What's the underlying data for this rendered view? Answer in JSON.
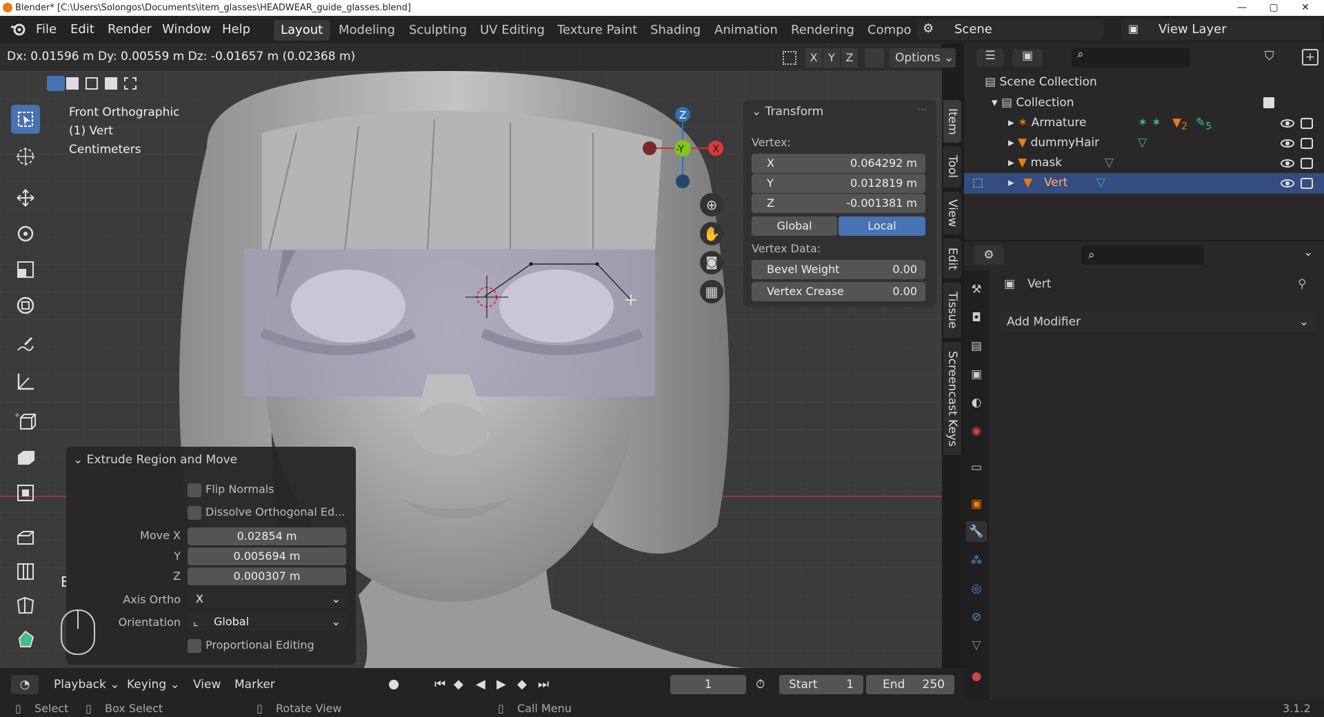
{
  "titlebar": {
    "title": "Blender* [C:\\Users\\Solongos\\Documents\\item_glasses\\HEADWEAR_guide_glasses.blend]",
    "min": "—",
    "max": "▢",
    "close": "✕"
  },
  "menu": [
    "File",
    "Edit",
    "Render",
    "Window",
    "Help"
  ],
  "workspaces": [
    "Layout",
    "Modeling",
    "Sculpting",
    "UV Editing",
    "Texture Paint",
    "Shading",
    "Animation",
    "Rendering",
    "Compo"
  ],
  "scene": {
    "label": "Scene",
    "view_layer": "View Layer"
  },
  "header": {
    "transform_readout": "Dx: 0.01596 m   Dy: 0.00559 m   Dz: -0.01657 m (0.02368 m)",
    "axis_x": "X",
    "axis_y": "Y",
    "axis_z": "Z",
    "options": "Options"
  },
  "viewport": {
    "view_name": "Front Orthographic",
    "object": "(1) Vert",
    "units": "Centimeters",
    "key_hint": "E"
  },
  "gizmo": {
    "z": "Z",
    "y": "-Y",
    "x": "X"
  },
  "npanel": {
    "section": "Transform",
    "vertex_label": "Vertex:",
    "x_label": "X",
    "x_val": "0.064292 m",
    "y_label": "Y",
    "y_val": "0.012819 m",
    "z_label": "Z",
    "z_val": "-0.001381 m",
    "global": "Global",
    "local": "Local",
    "vertex_data": "Vertex Data:",
    "bevel_label": "Bevel Weight",
    "bevel_val": "0.00",
    "crease_label": "Vertex Crease",
    "crease_val": "0.00"
  },
  "sidetabs": [
    "Item",
    "Tool",
    "View",
    "Edit",
    "Tissue",
    "Screencast Keys"
  ],
  "operator": {
    "title": "Extrude Region and Move",
    "flip": "Flip Normals",
    "dissolve": "Dissolve Orthogonal Ed...",
    "move_x_label": "Move X",
    "move_x": "0.02854 m",
    "y_label": "Y",
    "move_y": "0.005694 m",
    "z_label": "Z",
    "move_z": "0.000307 m",
    "axis_ortho_label": "Axis Ortho",
    "axis_ortho": "X",
    "orientation_label": "Orientation",
    "orientation": "Global",
    "proportional": "Proportional Editing"
  },
  "timeline": {
    "playback": "Playback",
    "keying": "Keying",
    "view": "View",
    "marker": "Marker",
    "frame": "1",
    "start_label": "Start",
    "start": "1",
    "end_label": "End",
    "end": "250"
  },
  "status": {
    "select": "Select",
    "box_select": "Box Select",
    "rotate_view": "Rotate View",
    "call_menu": "Call Menu",
    "version": "3.1.2"
  },
  "outliner": {
    "scene_collection": "Scene Collection",
    "collection": "Collection",
    "items": [
      {
        "name": "Armature",
        "badge1": "2",
        "badge2": "5"
      },
      {
        "name": "dummyHair"
      },
      {
        "name": "mask"
      },
      {
        "name": "Vert"
      }
    ]
  },
  "properties": {
    "object_name": "Vert",
    "add_modifier": "Add Modifier"
  },
  "colors": {
    "accent": "#4772b3",
    "selected_row": "#334d80",
    "orange": "#e87d0d",
    "green": "#3fbf8f"
  }
}
